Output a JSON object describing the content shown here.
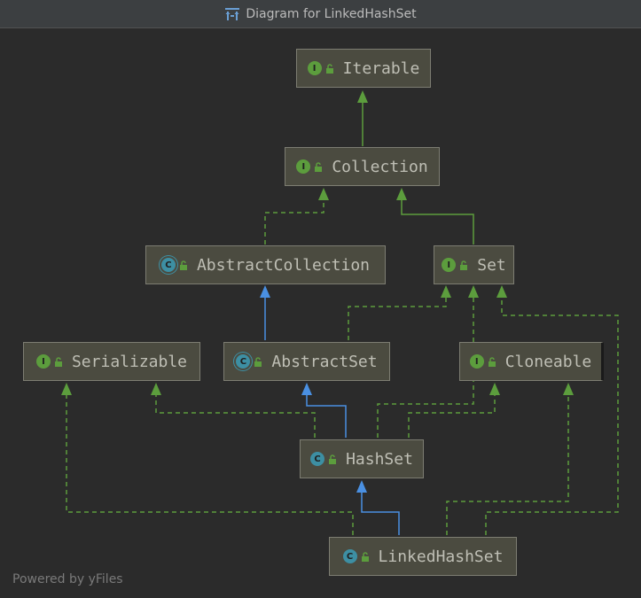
{
  "window": {
    "title": "Diagram for LinkedHashSet"
  },
  "nodes": {
    "iterable": {
      "label": "Iterable",
      "kind": "interface",
      "badge": "I"
    },
    "collection": {
      "label": "Collection",
      "kind": "interface",
      "badge": "I"
    },
    "abstract_collection": {
      "label": "AbstractCollection",
      "kind": "abstract-class",
      "badge": "C"
    },
    "set": {
      "label": "Set",
      "kind": "interface",
      "badge": "I"
    },
    "serializable": {
      "label": "Serializable",
      "kind": "interface",
      "badge": "I"
    },
    "abstract_set": {
      "label": "AbstractSet",
      "kind": "abstract-class",
      "badge": "C"
    },
    "cloneable": {
      "label": "Cloneable",
      "kind": "interface",
      "badge": "I"
    },
    "hash_set": {
      "label": "HashSet",
      "kind": "class",
      "badge": "C"
    },
    "linked_hash_set": {
      "label": "LinkedHashSet",
      "kind": "class",
      "badge": "C"
    }
  },
  "edges": [
    {
      "from": "Collection",
      "to": "Iterable",
      "type": "extends"
    },
    {
      "from": "AbstractCollection",
      "to": "Collection",
      "type": "implements"
    },
    {
      "from": "Set",
      "to": "Collection",
      "type": "extends"
    },
    {
      "from": "AbstractSet",
      "to": "AbstractCollection",
      "type": "extends-class"
    },
    {
      "from": "AbstractSet",
      "to": "Set",
      "type": "implements"
    },
    {
      "from": "HashSet",
      "to": "AbstractSet",
      "type": "extends-class"
    },
    {
      "from": "HashSet",
      "to": "Set",
      "type": "implements"
    },
    {
      "from": "HashSet",
      "to": "Serializable",
      "type": "implements"
    },
    {
      "from": "HashSet",
      "to": "Cloneable",
      "type": "implements"
    },
    {
      "from": "LinkedHashSet",
      "to": "HashSet",
      "type": "extends-class"
    },
    {
      "from": "LinkedHashSet",
      "to": "Set",
      "type": "implements"
    },
    {
      "from": "LinkedHashSet",
      "to": "Serializable",
      "type": "implements"
    },
    {
      "from": "LinkedHashSet",
      "to": "Cloneable",
      "type": "implements"
    }
  ],
  "colors": {
    "background": "#2b2b2b",
    "node_fill": "#4b4b40",
    "node_border": "#7d7d72",
    "interface_edge": "#5c9d3d",
    "class_edge": "#4a90e2",
    "interface_badge": "#5c9d3d",
    "class_badge": "#3d8fa3"
  },
  "footer": {
    "text": "Powered by yFiles"
  }
}
